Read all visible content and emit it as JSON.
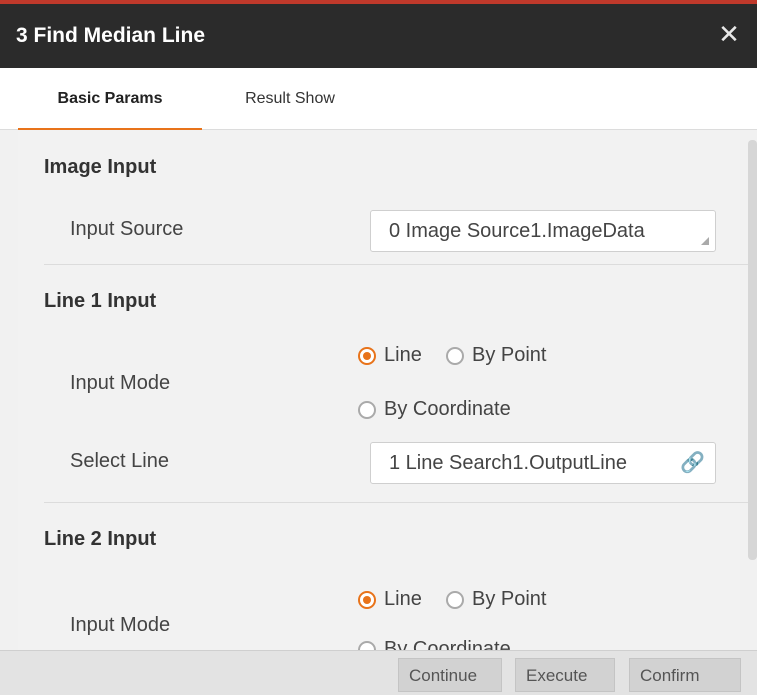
{
  "window": {
    "title": "3 Find Median Line",
    "close_symbol": "✕"
  },
  "tabs": [
    {
      "label": "Basic Params",
      "active": true
    },
    {
      "label": "Result Show",
      "active": false
    }
  ],
  "sections": {
    "image_input": {
      "title": "Image Input",
      "input_source_label": "Input Source",
      "input_source_value": "0 Image Source1.ImageData"
    },
    "line1_input": {
      "title": "Line 1 Input",
      "input_mode_label": "Input Mode",
      "options": [
        "Line",
        "By Point",
        "By Coordinate"
      ],
      "selected": "Line",
      "select_line_label": "Select Line",
      "select_line_value": "1 Line Search1.OutputLine"
    },
    "line2_input": {
      "title": "Line 2 Input",
      "input_mode_label": "Input Mode",
      "options": [
        "Line",
        "By Point",
        "By Coordinate"
      ],
      "selected": "Line"
    }
  },
  "footer": {
    "continue": "Continue",
    "execute": "Execute",
    "confirm": "Confirm"
  },
  "colors": {
    "accent": "#e8731a",
    "titlebar": "#2b2b2b",
    "top_border": "#c0392b"
  }
}
